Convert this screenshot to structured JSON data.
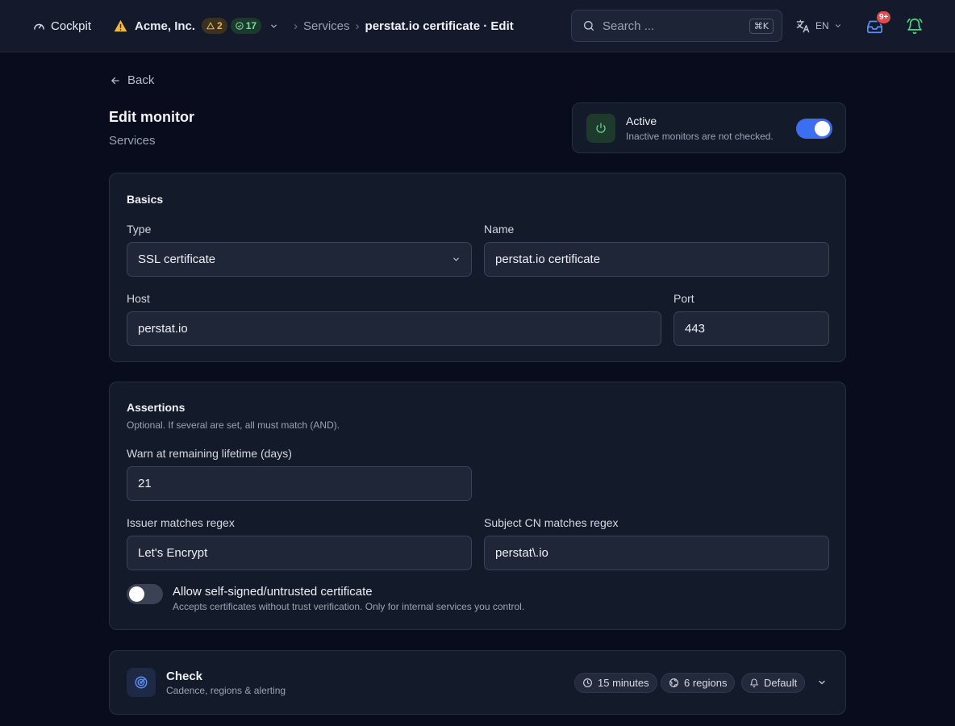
{
  "topbar": {
    "app_name": "Cockpit",
    "org_name": "Acme, Inc.",
    "warning_count": "2",
    "ok_count": "17",
    "breadcrumb": [
      "Services",
      "perstat.io certificate · Edit"
    ],
    "search_placeholder": "Search ...",
    "search_shortcut": "⌘K",
    "language": "EN",
    "inbox_badge": "9+"
  },
  "page": {
    "back_label": "Back",
    "title": "Edit monitor",
    "subtitle": "Services"
  },
  "active": {
    "title": "Active",
    "description": "Inactive monitors are not checked.",
    "enabled": true
  },
  "basics": {
    "section_title": "Basics",
    "type_label": "Type",
    "type_value": "SSL certificate",
    "name_label": "Name",
    "name_value": "perstat.io certificate",
    "host_label": "Host",
    "host_value": "perstat.io",
    "port_label": "Port",
    "port_value": "443"
  },
  "assertions": {
    "section_title": "Assertions",
    "description": "Optional. If several are set, all must match (AND).",
    "warn_label": "Warn at remaining lifetime (days)",
    "warn_value": "21",
    "issuer_label": "Issuer matches regex",
    "issuer_value": "Let's Encrypt",
    "subject_label": "Subject CN matches regex",
    "subject_value": "perstat\\.io",
    "self_signed_title": "Allow self-signed/untrusted certificate",
    "self_signed_desc": "Accepts certificates without trust verification. Only for internal services you control.",
    "self_signed_enabled": false
  },
  "check": {
    "title": "Check",
    "description": "Cadence, regions & alerting",
    "cadence": "15 minutes",
    "regions": "6 regions",
    "alerting": "Default"
  },
  "colors": {
    "accent": "#3b6ef0",
    "background": "#080c1c",
    "card": "#131a2a",
    "warning": "#e8b64a",
    "success": "#7fd6a0",
    "danger": "#e5484d"
  }
}
